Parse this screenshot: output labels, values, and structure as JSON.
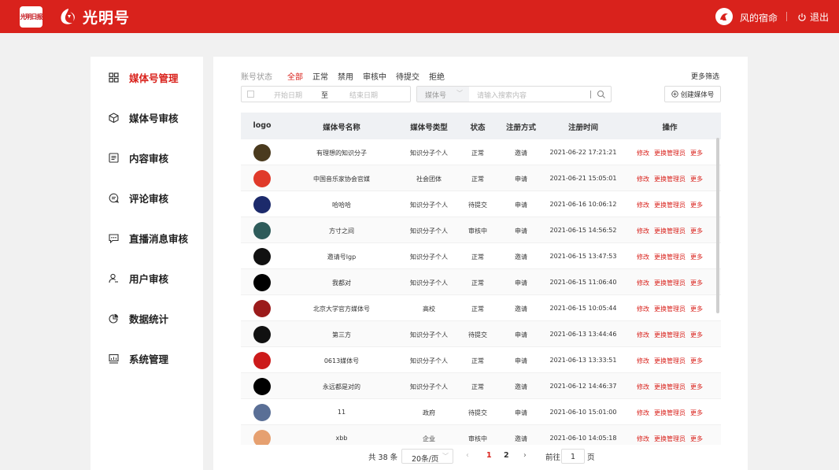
{
  "header": {
    "newspaper_logo": "光明日报",
    "brand": "光明号",
    "user_name": "风的宿命",
    "logout": "退出"
  },
  "sidebar": {
    "items": [
      {
        "label": "媒体号管理",
        "icon": "grid-icon",
        "active": true
      },
      {
        "label": "媒体号审核",
        "icon": "cube-icon"
      },
      {
        "label": "内容审核",
        "icon": "list-icon"
      },
      {
        "label": "评论审核",
        "icon": "comment-icon"
      },
      {
        "label": "直播消息审核",
        "icon": "chat-icon"
      },
      {
        "label": "用户审核",
        "icon": "user-icon"
      },
      {
        "label": "数据统计",
        "icon": "pie-icon"
      },
      {
        "label": "系统管理",
        "icon": "monitor-icon"
      }
    ]
  },
  "filters": {
    "status_label": "账号状态",
    "options": [
      "全部",
      "正常",
      "禁用",
      "审核中",
      "待提交",
      "拒绝"
    ],
    "active_option": "全部",
    "more_filters": "更多筛选",
    "date_start_placeholder": "开始日期",
    "date_to": "至",
    "date_end_placeholder": "结束日期",
    "search_type": "媒体号",
    "search_placeholder": "请输入搜索内容",
    "create_button": "创建媒体号"
  },
  "table": {
    "columns": [
      "logo",
      "媒体号名称",
      "媒体号类型",
      "状态",
      "注册方式",
      "注册时间",
      "操作"
    ],
    "rows": [
      {
        "name": "有理想的知识分子",
        "type": "知识分子个人",
        "status": "正常",
        "method": "邀请",
        "time": "2021-06-22 17:21:21",
        "logo_color": "#4a3a1e"
      },
      {
        "name": "中国音乐家协会官媒",
        "type": "社会团体",
        "status": "正常",
        "method": "申请",
        "time": "2021-06-21 15:05:01",
        "logo_color": "#e03a2a"
      },
      {
        "name": "哈哈哈",
        "type": "知识分子个人",
        "status": "待提交",
        "method": "申请",
        "time": "2021-06-16 10:06:12",
        "logo_color": "#1c2a6b"
      },
      {
        "name": "方寸之间",
        "type": "知识分子个人",
        "status": "审核中",
        "method": "申请",
        "time": "2021-06-15 14:56:52",
        "logo_color": "#2e5b5a"
      },
      {
        "name": "邀请号lgp",
        "type": "知识分子个人",
        "status": "正常",
        "method": "邀请",
        "time": "2021-06-15 13:47:53",
        "logo_color": "#111111"
      },
      {
        "name": "我都对",
        "type": "知识分子个人",
        "status": "正常",
        "method": "申请",
        "time": "2021-06-15 11:06:40",
        "logo_color": "#000000"
      },
      {
        "name": "北京大学官方媒体号",
        "type": "高校",
        "status": "正常",
        "method": "邀请",
        "time": "2021-06-15 10:05:44",
        "logo_color": "#9b1b1b"
      },
      {
        "name": "第三方",
        "type": "知识分子个人",
        "status": "待提交",
        "method": "申请",
        "time": "2021-06-13 13:44:46",
        "logo_color": "#111111"
      },
      {
        "name": "0613媒体号",
        "type": "知识分子个人",
        "status": "正常",
        "method": "申请",
        "time": "2021-06-13 13:33:51",
        "logo_color": "#cc1a1a"
      },
      {
        "name": "永远都是对的",
        "type": "知识分子个人",
        "status": "正常",
        "method": "邀请",
        "time": "2021-06-12 14:46:37",
        "logo_color": "#000000"
      },
      {
        "name": "11",
        "type": "政府",
        "status": "待提交",
        "method": "申请",
        "time": "2021-06-10 15:01:00",
        "logo_color": "#5a6f96"
      },
      {
        "name": "xbb",
        "type": "企业",
        "status": "审核中",
        "method": "邀请",
        "time": "2021-06-10 14:05:18",
        "logo_color": "#e6a070"
      }
    ],
    "actions": [
      "修改",
      "更换管理员",
      "更多"
    ]
  },
  "pagination": {
    "total": "共 38 条",
    "page_size": "20条/页",
    "pages": [
      "1",
      "2"
    ],
    "current_page": "1",
    "goto_label": "前往",
    "goto_value": "1",
    "page_suffix": "页"
  },
  "colors": {
    "brand_red": "#d9221c",
    "background": "#f1f1f1"
  }
}
